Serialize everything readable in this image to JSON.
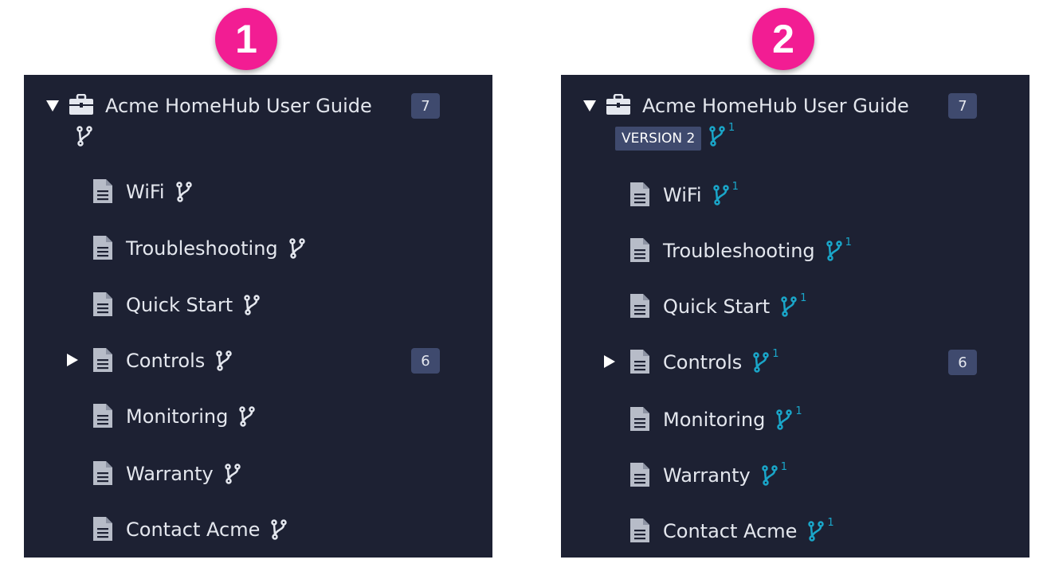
{
  "markers": [
    "1",
    "2"
  ],
  "colors": {
    "panel_bg": "#1d2133",
    "marker_bg": "#f21d93",
    "badge_bg": "#3f4a6e",
    "fork_default": "#e4e7ee",
    "fork_highlight": "#1aa6c9"
  },
  "panel_1": {
    "title": "Acme HomeHub User Guide",
    "title_badge": "7",
    "title_icon": "briefcase-icon",
    "items": [
      {
        "label": "WiFi"
      },
      {
        "label": "Troubleshooting"
      },
      {
        "label": "Quick Start"
      },
      {
        "label": "Controls",
        "badge": "6",
        "expandable": true
      },
      {
        "label": "Monitoring"
      },
      {
        "label": "Warranty"
      },
      {
        "label": "Contact Acme"
      }
    ]
  },
  "panel_2": {
    "title": "Acme HomeHub User Guide",
    "title_badge": "7",
    "title_icon": "briefcase-icon",
    "version_tag": "VERSION 2",
    "fork_count": "1",
    "items": [
      {
        "label": "WiFi",
        "fork_count": "1"
      },
      {
        "label": "Troubleshooting",
        "fork_count": "1"
      },
      {
        "label": "Quick Start",
        "fork_count": "1"
      },
      {
        "label": "Controls",
        "fork_count": "1",
        "badge": "6",
        "expandable": true
      },
      {
        "label": "Monitoring",
        "fork_count": "1"
      },
      {
        "label": "Warranty",
        "fork_count": "1"
      },
      {
        "label": "Contact Acme",
        "fork_count": "1"
      }
    ]
  }
}
